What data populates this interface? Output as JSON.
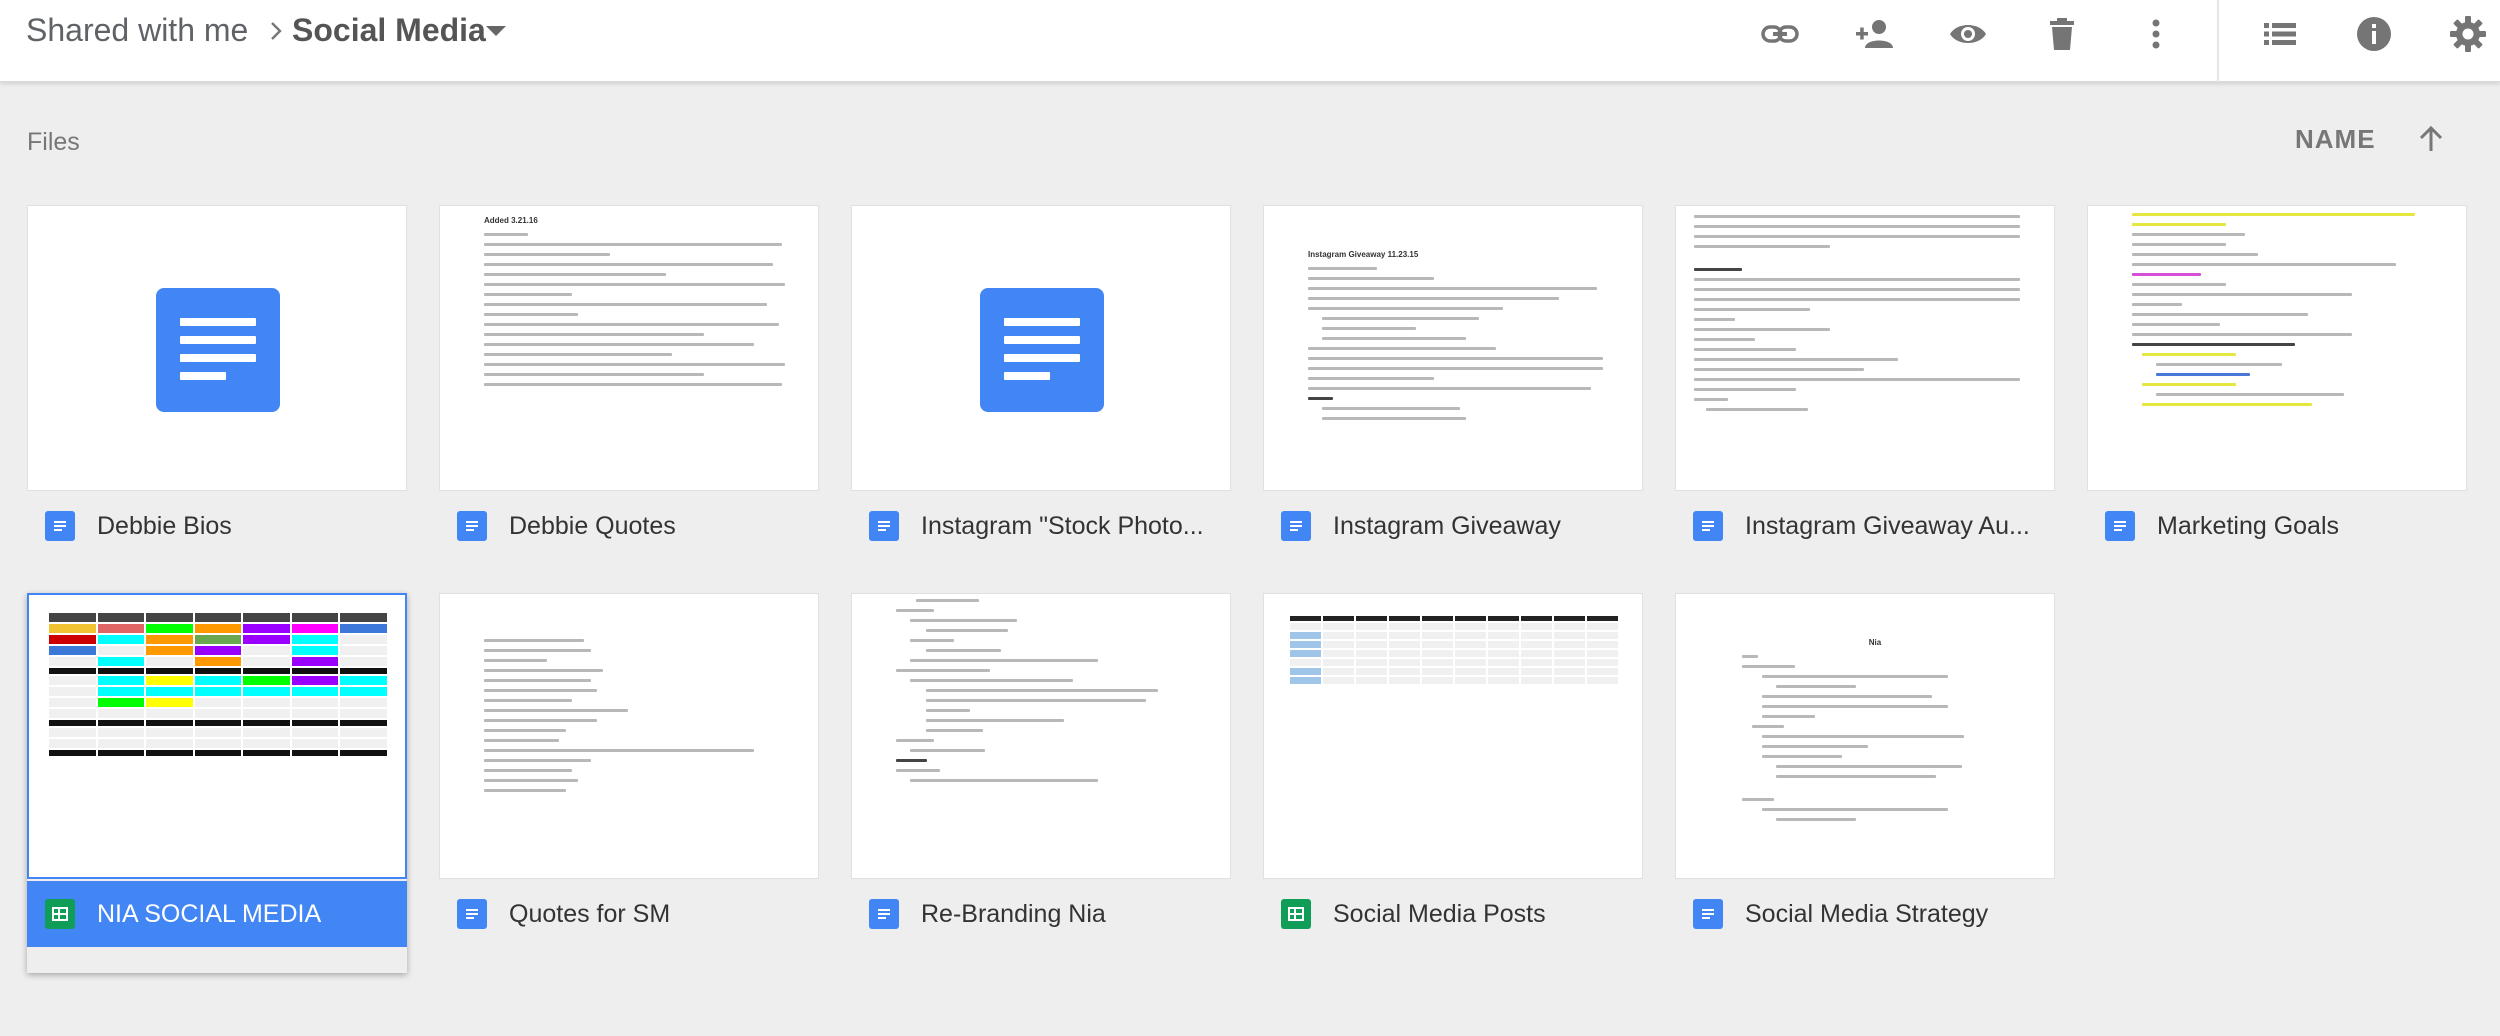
{
  "breadcrumb": {
    "root": "Shared with me",
    "current": "Social Media"
  },
  "toolbar": {
    "icons": [
      "link-icon",
      "add-person-icon",
      "preview-eye-icon",
      "trash-icon",
      "more-vert-icon",
      "list-view-icon",
      "info-icon",
      "settings-icon"
    ]
  },
  "section": {
    "title": "Files",
    "sort_label": "NAME"
  },
  "colors": {
    "doc_blue": "#4285f4",
    "sheet_green": "#0f9d58",
    "selected": "#4285f4",
    "background": "#eeeeee"
  },
  "files": [
    {
      "name": "Debbie Bios",
      "type": "doc"
    },
    {
      "name": "Debbie Quotes",
      "type": "doc"
    },
    {
      "name": "Instagram \"Stock Photo...",
      "type": "doc"
    },
    {
      "name": "Instagram Giveaway",
      "type": "doc"
    },
    {
      "name": "Instagram Giveaway Au...",
      "type": "doc"
    },
    {
      "name": "Marketing Goals",
      "type": "doc"
    },
    {
      "name": "NIA SOCIAL MEDIA",
      "type": "sheet",
      "selected": true
    },
    {
      "name": "Quotes for SM",
      "type": "doc"
    },
    {
      "name": "Re-Branding Nia",
      "type": "doc"
    },
    {
      "name": "Social Media Posts",
      "type": "sheet"
    },
    {
      "name": "Social Media Strategy",
      "type": "doc"
    }
  ],
  "thumbs": {
    "debbie_quotes_heading": "Added 3.21.16",
    "giveaway_heading": "Instagram Giveaway 11.23.15",
    "strategy_heading": "Nia"
  }
}
